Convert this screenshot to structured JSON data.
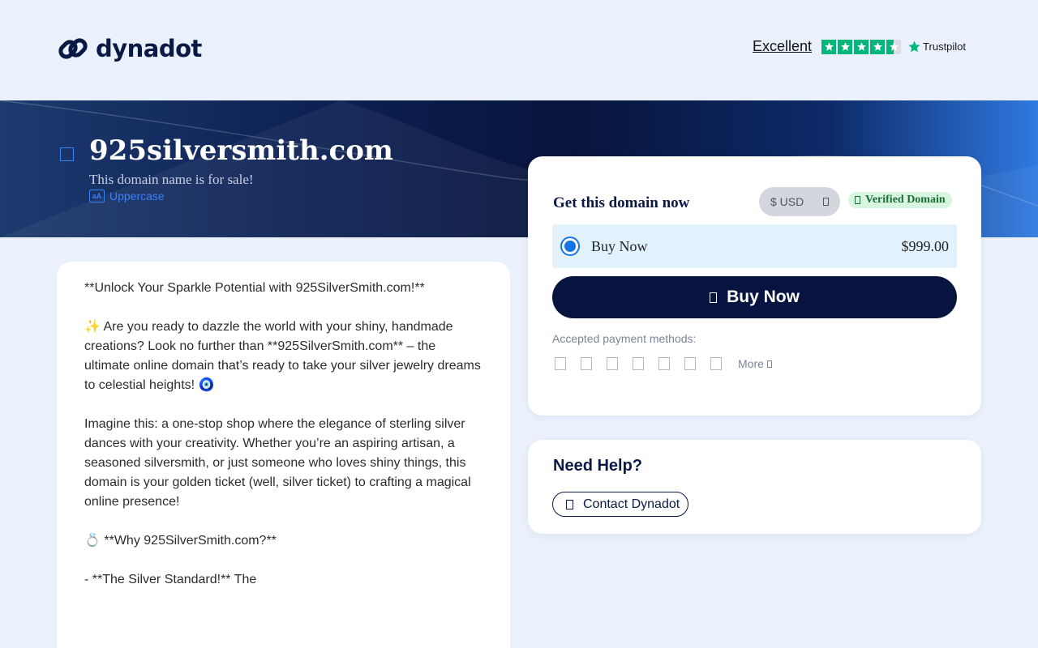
{
  "header": {
    "brand": "dynadot",
    "trustpilot": {
      "rating_text": "Excellent",
      "stars": 4.5,
      "brand": "Trustpilot",
      "color": "#00b67a"
    }
  },
  "hero": {
    "domain": "925silversmith.com",
    "subtitle": "This domain name is for sale!",
    "case_label": "Uppercase"
  },
  "description": {
    "paragraphs": [
      "**Unlock Your Sparkle Potential with 925SilverSmith.com!**",
      "✨ Are you ready to dazzle the world with your shiny, handmade creations? Look no further than **925SilverSmith.com** – the ultimate online domain that’s ready to take your silver jewelry dreams to celestial heights! 🧿",
      "Imagine this: a one-stop shop where the elegance of sterling silver dances with your creativity. Whether you’re an aspiring artisan, a seasoned silversmith, or just someone who loves shiny things, this domain is your golden ticket (well, silver ticket) to crafting a magical online presence!",
      "💍 **Why 925SilverSmith.com?**",
      "- **The Silver Standard!** The"
    ]
  },
  "purchase": {
    "heading": "Get this domain now",
    "currency": "$ USD",
    "verified": "Verified Domain",
    "option_label": "Buy Now",
    "price": "$999.00",
    "buy_button": "Buy Now",
    "payment_label": "Accepted payment methods:",
    "payment_icons": [
      "visa-icon",
      "mastercard-icon",
      "amex-icon",
      "discover-icon",
      "paypal-icon",
      "alipay-icon",
      "bank-transfer-icon"
    ],
    "more_label": "More",
    "accent_color": "#081440"
  },
  "help": {
    "title": "Need Help?",
    "contact_button": "Contact Dynadot"
  }
}
